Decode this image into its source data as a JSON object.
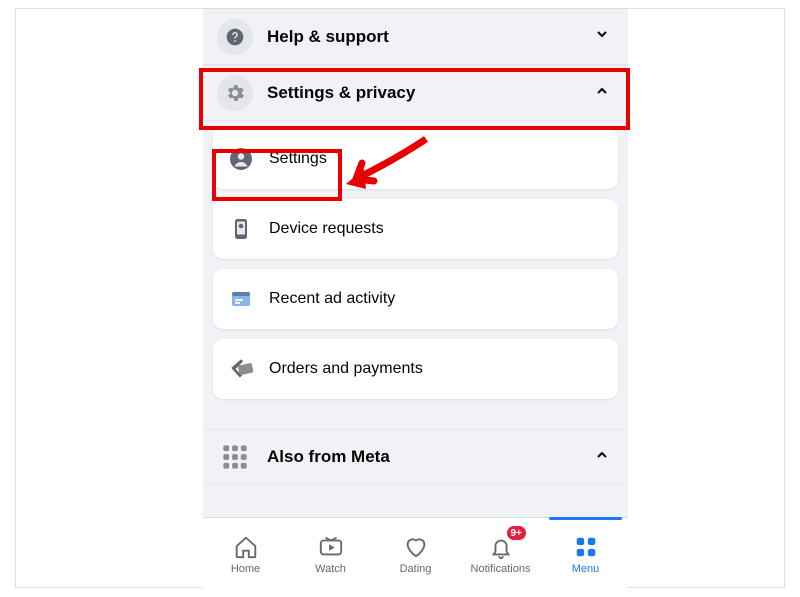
{
  "sections": {
    "help": {
      "label": "Help & support",
      "expanded": false
    },
    "settings_privacy": {
      "label": "Settings & privacy",
      "expanded": true,
      "items": [
        {
          "label": "Settings"
        },
        {
          "label": "Device requests"
        },
        {
          "label": "Recent ad activity"
        },
        {
          "label": "Orders and payments"
        }
      ]
    },
    "also_meta": {
      "label": "Also from Meta",
      "expanded": true
    }
  },
  "nav": {
    "home": "Home",
    "watch": "Watch",
    "dating": "Dating",
    "notifications": "Notifications",
    "menu": "Menu",
    "badge": "9+"
  },
  "colors": {
    "accent": "#1877f2",
    "badge": "#e41e3f",
    "highlight": "#e80000"
  }
}
